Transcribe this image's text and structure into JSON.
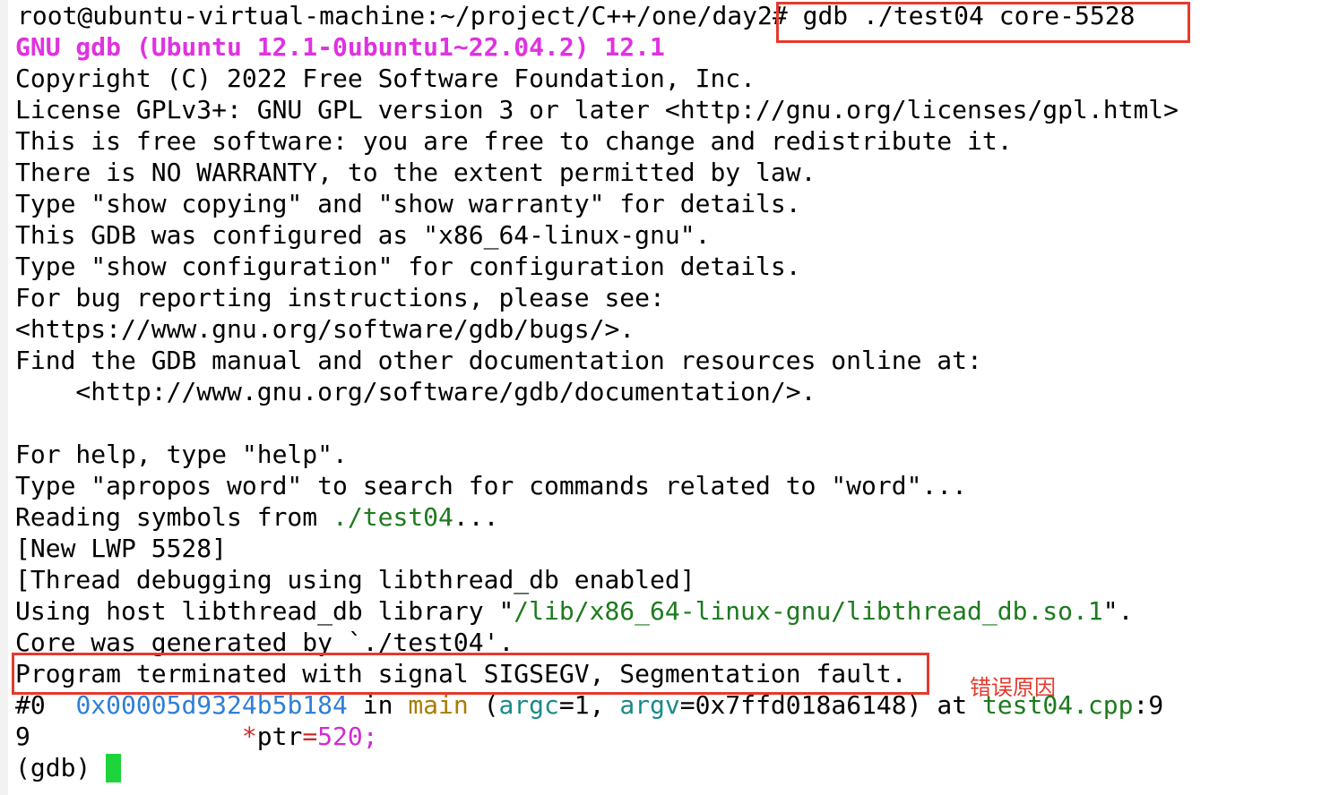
{
  "terminal": {
    "prompt": "root@ubuntu-virtual-machine:~/project/C++/one/day2",
    "command": "# gdb ./test04 core-5528",
    "gdb_version": "GNU gdb (Ubuntu 12.1-0ubuntu1~22.04.2) 12.1",
    "lines": [
      "Copyright (C) 2022 Free Software Foundation, Inc.",
      "License GPLv3+: GNU GPL version 3 or later <http://gnu.org/licenses/gpl.html>",
      "This is free software: you are free to change and redistribute it.",
      "There is NO WARRANTY, to the extent permitted by law.",
      "Type \"show copying\" and \"show warranty\" for details.",
      "This GDB was configured as \"x86_64-linux-gnu\".",
      "Type \"show configuration\" for configuration details.",
      "For bug reporting instructions, please see:",
      "<https://www.gnu.org/software/gdb/bugs/>.",
      "Find the GDB manual and other documentation resources online at:",
      "    <http://www.gnu.org/software/gdb/documentation/>.",
      "",
      "For help, type \"help\".",
      "Type \"apropos word\" to search for commands related to \"word\"..."
    ],
    "reading_prefix": "Reading symbols from ",
    "reading_file": "./test04",
    "reading_suffix": "...",
    "new_lwp": "[New LWP 5528]",
    "thread_debug": "[Thread debugging using libthread_db enabled]",
    "using_host_prefix": "Using host libthread_db library \"",
    "using_host_path": "/lib/x86_64-linux-gnu/libthread_db.so.1",
    "using_host_suffix": "\".",
    "core_generated": "Core was generated by `./test04'.",
    "signal_line": "Program terminated with signal SIGSEGV, Segmentation fault.",
    "frame": {
      "index": "#0  ",
      "address": "0x00005d9324b5b184",
      "in": " in ",
      "func": "main",
      "open": " (",
      "arg1": "argc",
      "eq1": "=1, ",
      "arg2": "argv",
      "eq2": "=0x7ffd018a6148) at ",
      "file": "test04.cpp",
      "lineno": ":9"
    },
    "source": {
      "lineno": "9",
      "indent": "              ",
      "star": "*",
      "code1": "ptr",
      "eq": "=",
      "value": "520;"
    },
    "gdb_prompt": "(gdb) "
  },
  "annotation": {
    "label": "错误原因"
  },
  "colors": {
    "highlight_box": "#e53a2d",
    "cursor": "#1ed43c",
    "path_green": "#1d7a1d",
    "address_blue": "#2f7fd6",
    "version_magenta": "#e032e0"
  }
}
